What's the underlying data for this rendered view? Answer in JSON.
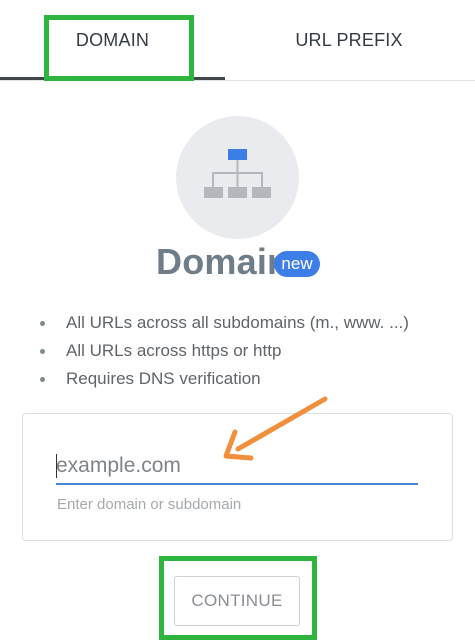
{
  "tabs": {
    "domain_label": "DOMAIN",
    "url_prefix_label": "URL PREFIX",
    "active": "DOMAIN"
  },
  "property": {
    "icon": "sitemap-icon",
    "title": "Domain",
    "badge": "new",
    "features": [
      "All URLs across all subdomains (m., www. ...)",
      "All URLs across https or http",
      "Requires DNS verification"
    ]
  },
  "input": {
    "value": "",
    "placeholder": "example.com",
    "hint": "Enter domain or subdomain"
  },
  "continue_label": "CONTINUE",
  "colors": {
    "highlight": "#2db53d",
    "arrow": "#f0903d",
    "accent": "#3d7ee6",
    "input_underline": "#4a86d8"
  }
}
